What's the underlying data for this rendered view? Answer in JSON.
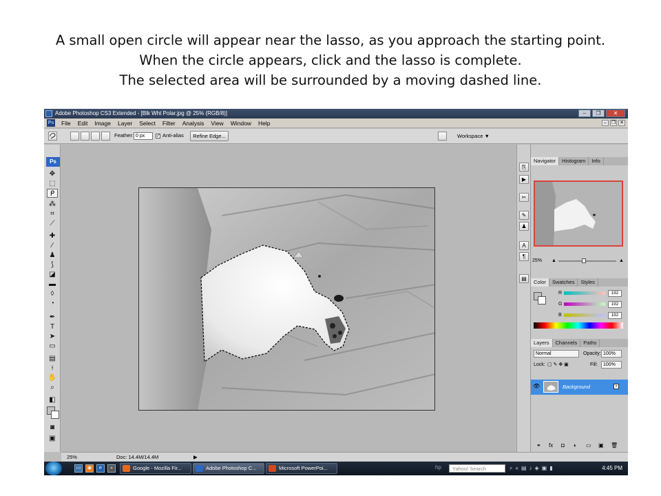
{
  "caption": {
    "line1": "A small open circle will appear near the lasso, as you approach the starting point.",
    "line2": "When the circle appears, click and the lasso is complete.",
    "line3": "The selected area will be surrounded by a moving dashed line."
  },
  "window": {
    "title": "Adobe Photoshop CS3 Extended - [Blk Wht Polar.jpg @ 25% (RGB/8)]"
  },
  "menu": [
    "File",
    "Edit",
    "Image",
    "Layer",
    "Select",
    "Filter",
    "Analysis",
    "View",
    "Window",
    "Help"
  ],
  "options_bar": {
    "feather_label": "Feather:",
    "feather_value": "0 px",
    "antialias_label": "Anti-alias",
    "antialias_checked": true,
    "refine_edge_label": "Refine Edge...",
    "workspace_label": "Workspace ▼"
  },
  "toolbox": {
    "badge": "Ps"
  },
  "status_bar": {
    "zoom": "25%",
    "doc": "Doc: 14.4M/14.4M"
  },
  "navigator": {
    "tabs": [
      "Navigator",
      "Histogram",
      "Info"
    ],
    "zoom": "25%"
  },
  "color_panel": {
    "tabs": [
      "Color",
      "Swatches",
      "Styles"
    ],
    "channels": [
      {
        "label": "R",
        "value": "192"
      },
      {
        "label": "G",
        "value": "192"
      },
      {
        "label": "B",
        "value": "192"
      }
    ]
  },
  "layers_panel": {
    "tabs": [
      "Layers",
      "Channels",
      "Paths"
    ],
    "blend_mode": "Normal",
    "opacity_label": "Opacity:",
    "opacity_value": "100%",
    "lock_label": "Lock:",
    "fill_label": "Fill:",
    "fill_value": "100%",
    "layer_name": "Background"
  },
  "taskbar": {
    "tasks": [
      {
        "label": "Google - Mozilla Fir...",
        "color": "#e66a1e"
      },
      {
        "label": "Adobe Photoshop C...",
        "color": "#2d67c4"
      },
      {
        "label": "Microsoft PowerPoi...",
        "color": "#d24726"
      }
    ],
    "search_placeholder": "Yahoo! Search",
    "clock": "4:45 PM"
  },
  "colors": {
    "foreground": "#c0c0c0",
    "background": "#ffffff",
    "layer_selected": "#3f8ee4"
  }
}
